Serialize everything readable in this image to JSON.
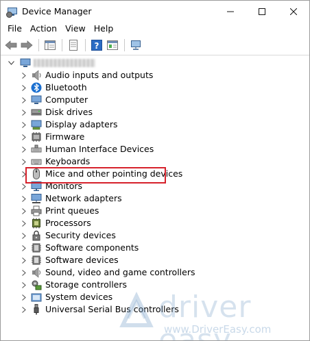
{
  "window": {
    "title": "Device Manager",
    "controls": {
      "minimize": "—",
      "maximize": "☐",
      "close": "✕"
    }
  },
  "menu": [
    {
      "label": "File"
    },
    {
      "label": "Action"
    },
    {
      "label": "View"
    },
    {
      "label": "Help"
    }
  ],
  "tree": {
    "root_label_blurred": true,
    "items": [
      {
        "label": "Audio inputs and outputs",
        "icon": "audio-icon"
      },
      {
        "label": "Bluetooth",
        "icon": "bluetooth-icon"
      },
      {
        "label": "Computer",
        "icon": "computer-icon"
      },
      {
        "label": "Disk drives",
        "icon": "disk-icon"
      },
      {
        "label": "Display adapters",
        "icon": "display-adapter-icon"
      },
      {
        "label": "Firmware",
        "icon": "firmware-icon"
      },
      {
        "label": "Human Interface Devices",
        "icon": "hid-icon"
      },
      {
        "label": "Keyboards",
        "icon": "keyboard-icon"
      },
      {
        "label": "Mice and other pointing devices",
        "icon": "mouse-icon",
        "highlighted": true
      },
      {
        "label": "Monitors",
        "icon": "monitor-icon"
      },
      {
        "label": "Network adapters",
        "icon": "network-icon"
      },
      {
        "label": "Print queues",
        "icon": "printer-icon"
      },
      {
        "label": "Processors",
        "icon": "processor-icon"
      },
      {
        "label": "Security devices",
        "icon": "security-icon"
      },
      {
        "label": "Software components",
        "icon": "software-component-icon"
      },
      {
        "label": "Software devices",
        "icon": "software-device-icon"
      },
      {
        "label": "Sound, video and game controllers",
        "icon": "sound-icon"
      },
      {
        "label": "Storage controllers",
        "icon": "storage-icon"
      },
      {
        "label": "System devices",
        "icon": "system-icon"
      },
      {
        "label": "Universal Serial Bus controllers",
        "icon": "usb-icon"
      }
    ]
  },
  "watermark": {
    "brand": "driver easy",
    "url": "www.DriverEasy.com"
  },
  "colors": {
    "highlight_border": "#d6202a",
    "accent_blue": "#2b6cc4"
  }
}
